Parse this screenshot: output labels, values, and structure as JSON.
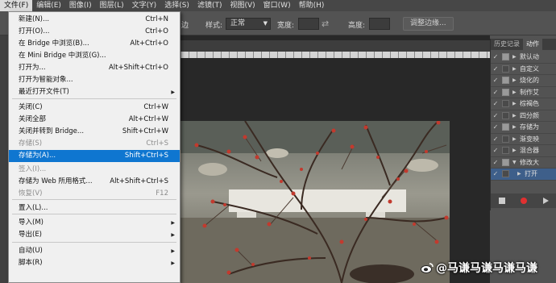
{
  "menubar": {
    "items": [
      {
        "label": "文件(F)",
        "active": true
      },
      {
        "label": "编辑(E)"
      },
      {
        "label": "图像(I)"
      },
      {
        "label": "图层(L)"
      },
      {
        "label": "文字(Y)"
      },
      {
        "label": "选择(S)"
      },
      {
        "label": "滤镜(T)"
      },
      {
        "label": "视图(V)"
      },
      {
        "label": "窗口(W)"
      },
      {
        "label": "帮助(H)"
      }
    ]
  },
  "options_bar": {
    "edge_label": "边",
    "style_label": "样式:",
    "style_value": "正常",
    "width_label": "宽度:",
    "height_label": "高度:",
    "refine_edge_button": "调整边缘..."
  },
  "file_menu": {
    "items": [
      {
        "label": "新建(N)...",
        "shortcut": "Ctrl+N"
      },
      {
        "label": "打开(O)...",
        "shortcut": "Ctrl+O"
      },
      {
        "label": "在 Bridge 中浏览(B)...",
        "shortcut": "Alt+Ctrl+O"
      },
      {
        "label": "在 Mini Bridge 中浏览(G)...",
        "shortcut": ""
      },
      {
        "label": "打开为...",
        "shortcut": "Alt+Shift+Ctrl+O"
      },
      {
        "label": "打开为智能对象...",
        "shortcut": ""
      },
      {
        "label": "最近打开文件(T)",
        "shortcut": "",
        "submenu": true
      },
      {
        "label": "关闭(C)",
        "shortcut": "Ctrl+W"
      },
      {
        "label": "关闭全部",
        "shortcut": "Alt+Ctrl+W"
      },
      {
        "label": "关闭并转到 Bridge...",
        "shortcut": "Shift+Ctrl+W"
      },
      {
        "label": "存储(S)",
        "shortcut": "Ctrl+S",
        "disabled": true
      },
      {
        "label": "存储为(A)...",
        "shortcut": "Shift+Ctrl+S",
        "selected": true
      },
      {
        "label": "签入(I)...",
        "shortcut": "",
        "disabled": true
      },
      {
        "label": "存储为 Web 所用格式...",
        "shortcut": "Alt+Shift+Ctrl+S"
      },
      {
        "label": "恢复(V)",
        "shortcut": "F12",
        "disabled": true
      },
      {
        "label": "置入(L)...",
        "shortcut": ""
      },
      {
        "label": "导入(M)",
        "shortcut": "",
        "submenu": true
      },
      {
        "label": "导出(E)",
        "shortcut": "",
        "submenu": true
      },
      {
        "label": "自动(U)",
        "shortcut": "",
        "submenu": true
      },
      {
        "label": "脚本(R)",
        "shortcut": "",
        "submenu": true
      }
    ]
  },
  "actions_panel": {
    "tabs": [
      "历史记录",
      "动作"
    ],
    "active_tab": "动作",
    "rows": [
      {
        "label": "默认动",
        "box": true
      },
      {
        "label": "自定义",
        "box": false
      },
      {
        "label": "烧化的",
        "box": true
      },
      {
        "label": "制作艾",
        "box": true
      },
      {
        "label": "棕褐色",
        "box": false
      },
      {
        "label": "四分颜",
        "box": false
      },
      {
        "label": "存储为",
        "box": true
      },
      {
        "label": "渐变映",
        "box": false
      },
      {
        "label": "混合器",
        "box": false
      },
      {
        "label": "修改大",
        "box": true,
        "expanded": true
      },
      {
        "label": "打开",
        "box": false,
        "selected": true,
        "indent": true
      }
    ]
  },
  "watermark": {
    "text": "@马谦马谦马谦马谦",
    "logo": "weibo-logo"
  }
}
